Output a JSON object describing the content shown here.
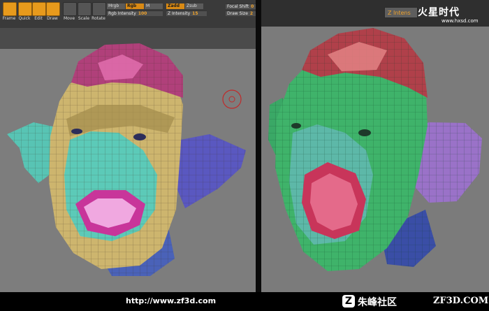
{
  "left_view": {
    "tools": [
      {
        "label": "Frame"
      },
      {
        "label": "Quick"
      },
      {
        "label": "Edit"
      },
      {
        "label": "Draw"
      },
      {
        "label": "Move"
      },
      {
        "label": "Scale"
      },
      {
        "label": "Rotate"
      }
    ],
    "mrgb_label": "Mrgb",
    "rgb_label": "Rgb",
    "m_label": "M",
    "rgb_intensity_label": "Rgb Intensity",
    "rgb_intensity_value": "100",
    "zadd_label": "Zadd",
    "zsub_label": "Zsub",
    "z_intensity_label": "Z Intensity",
    "z_intensity_value": "15",
    "focal_shift_label": "Focal Shift",
    "focal_shift_value": "0",
    "draw_size_label": "Draw Size",
    "draw_size_value": "2"
  },
  "right_view": {
    "z_intensity_label": "Z Intens",
    "logo_text": "火星时代",
    "logo_url": "www.hxsd.com"
  },
  "footer": {
    "url": "http://www.zf3d.com",
    "brand_cn": "朱峰社区",
    "brand_site": "ZF3D.COM",
    "logo_letter": "Z"
  },
  "colors": {
    "accent": "#e79a1c",
    "skin_left": "#c8b06a",
    "cap_left": "#b0407a",
    "mouth_left": "#4ec6b0",
    "ear_left": "#5a58c0",
    "skin_right": "#3fb36a",
    "cap_right": "#b0404a",
    "ear_right": "#8a62b8"
  }
}
